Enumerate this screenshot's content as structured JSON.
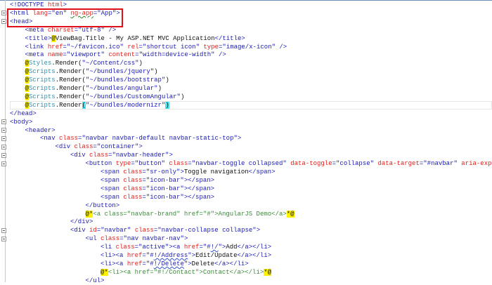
{
  "editor": {
    "lines": [
      {
        "indent": 0,
        "fold": false,
        "tokens": [
          {
            "t": "tag",
            "v": "<!DOCTYPE "
          },
          {
            "t": "attr",
            "v": "html"
          },
          {
            "t": "tag",
            "v": ">"
          }
        ]
      },
      {
        "indent": 0,
        "fold": true,
        "tokens": [
          {
            "t": "tag",
            "v": "<html "
          },
          {
            "t": "attr",
            "v": "lang"
          },
          {
            "t": "tag",
            "v": "="
          },
          {
            "t": "val",
            "v": "\"en\" "
          },
          {
            "t": "attr-squig",
            "v": "ng-app"
          },
          {
            "t": "tag",
            "v": "="
          },
          {
            "t": "val",
            "v": "\"App\""
          },
          {
            "t": "tag",
            "v": ">"
          }
        ]
      },
      {
        "indent": 0,
        "fold": true,
        "tokens": [
          {
            "t": "tag",
            "v": "<head>"
          }
        ]
      },
      {
        "indent": 1,
        "fold": false,
        "tokens": [
          {
            "t": "tag",
            "v": "<meta "
          },
          {
            "t": "attr",
            "v": "charset"
          },
          {
            "t": "tag",
            "v": "="
          },
          {
            "t": "val",
            "v": "\"utf-8\" "
          },
          {
            "t": "tag",
            "v": "/>"
          }
        ]
      },
      {
        "indent": 1,
        "fold": false,
        "tokens": [
          {
            "t": "tag",
            "v": "<title>"
          },
          {
            "t": "razor",
            "v": "@"
          },
          {
            "t": "text",
            "v": "ViewBag.Title - My ASP.NET MVC Application"
          },
          {
            "t": "tag",
            "v": "</title>"
          }
        ]
      },
      {
        "indent": 1,
        "fold": false,
        "tokens": [
          {
            "t": "tag",
            "v": "<link "
          },
          {
            "t": "attr",
            "v": "href"
          },
          {
            "t": "tag",
            "v": "="
          },
          {
            "t": "val",
            "v": "\"~/favicon.ico\" "
          },
          {
            "t": "attr",
            "v": "rel"
          },
          {
            "t": "tag",
            "v": "="
          },
          {
            "t": "val",
            "v": "\"shortcut icon\" "
          },
          {
            "t": "attr",
            "v": "type"
          },
          {
            "t": "tag",
            "v": "="
          },
          {
            "t": "val",
            "v": "\"image/x-icon\" "
          },
          {
            "t": "tag",
            "v": "/>"
          }
        ]
      },
      {
        "indent": 1,
        "fold": false,
        "tokens": [
          {
            "t": "tag",
            "v": "<meta "
          },
          {
            "t": "attr",
            "v": "name"
          },
          {
            "t": "tag",
            "v": "="
          },
          {
            "t": "val",
            "v": "\"viewport\" "
          },
          {
            "t": "attr",
            "v": "content"
          },
          {
            "t": "tag",
            "v": "="
          },
          {
            "t": "val",
            "v": "\"width=device-width\" "
          },
          {
            "t": "tag",
            "v": "/>"
          }
        ]
      },
      {
        "indent": 1,
        "fold": false,
        "tokens": [
          {
            "t": "razor",
            "v": "@"
          },
          {
            "t": "type",
            "v": "Styles"
          },
          {
            "t": "text",
            "v": ".Render("
          },
          {
            "t": "val",
            "v": "\"~/Content/css\""
          },
          {
            "t": "text",
            "v": ")"
          }
        ]
      },
      {
        "indent": 1,
        "fold": false,
        "tokens": [
          {
            "t": "razor",
            "v": "@"
          },
          {
            "t": "type",
            "v": "Scripts"
          },
          {
            "t": "text",
            "v": ".Render("
          },
          {
            "t": "val",
            "v": "\"~/bundles/jquery\""
          },
          {
            "t": "text",
            "v": ")"
          }
        ]
      },
      {
        "indent": 1,
        "fold": false,
        "tokens": [
          {
            "t": "razor",
            "v": "@"
          },
          {
            "t": "type",
            "v": "Scripts"
          },
          {
            "t": "text",
            "v": ".Render("
          },
          {
            "t": "val",
            "v": "\"~/bundles/bootstrap\""
          },
          {
            "t": "text",
            "v": ")"
          }
        ]
      },
      {
        "indent": 1,
        "fold": false,
        "tokens": [
          {
            "t": "razor",
            "v": "@"
          },
          {
            "t": "type",
            "v": "Scripts"
          },
          {
            "t": "text",
            "v": ".Render("
          },
          {
            "t": "val",
            "v": "\"~/bundles/angular\""
          },
          {
            "t": "text",
            "v": ")"
          }
        ]
      },
      {
        "indent": 1,
        "fold": false,
        "tokens": [
          {
            "t": "razor",
            "v": "@"
          },
          {
            "t": "type",
            "v": "Scripts"
          },
          {
            "t": "text",
            "v": ".Render("
          },
          {
            "t": "val",
            "v": "\"~/bundles/CustomAngular\""
          },
          {
            "t": "text",
            "v": ")"
          }
        ]
      },
      {
        "indent": 1,
        "fold": false,
        "tokens": [
          {
            "t": "razor",
            "v": "@"
          },
          {
            "t": "type",
            "v": "Scripts"
          },
          {
            "t": "text",
            "v": ".Render"
          },
          {
            "t": "brace",
            "v": "("
          },
          {
            "t": "val",
            "v": "\"~/bundles/modernizr\""
          },
          {
            "t": "brace",
            "v": ")"
          }
        ]
      },
      {
        "indent": 0,
        "fold": false,
        "tokens": [
          {
            "t": "tag",
            "v": "</head>"
          }
        ]
      },
      {
        "indent": 0,
        "fold": true,
        "tokens": [
          {
            "t": "tag",
            "v": "<body>"
          }
        ]
      },
      {
        "indent": 1,
        "fold": true,
        "tokens": [
          {
            "t": "tag",
            "v": "<header>"
          }
        ]
      },
      {
        "indent": 2,
        "fold": true,
        "tokens": [
          {
            "t": "tag",
            "v": "<nav "
          },
          {
            "t": "attr",
            "v": "class"
          },
          {
            "t": "tag",
            "v": "="
          },
          {
            "t": "val",
            "v": "\"navbar navbar-default navbar-static-top\""
          },
          {
            "t": "tag",
            "v": ">"
          }
        ]
      },
      {
        "indent": 3,
        "fold": true,
        "tokens": [
          {
            "t": "tag",
            "v": "<div "
          },
          {
            "t": "attr",
            "v": "class"
          },
          {
            "t": "tag",
            "v": "="
          },
          {
            "t": "val",
            "v": "\"container\""
          },
          {
            "t": "tag",
            "v": ">"
          }
        ]
      },
      {
        "indent": 4,
        "fold": true,
        "tokens": [
          {
            "t": "tag",
            "v": "<div "
          },
          {
            "t": "attr",
            "v": "class"
          },
          {
            "t": "tag",
            "v": "="
          },
          {
            "t": "val",
            "v": "\"navbar-header\""
          },
          {
            "t": "tag",
            "v": ">"
          }
        ]
      },
      {
        "indent": 5,
        "fold": true,
        "tokens": [
          {
            "t": "tag",
            "v": "<button "
          },
          {
            "t": "attr",
            "v": "type"
          },
          {
            "t": "tag",
            "v": "="
          },
          {
            "t": "val",
            "v": "\"button\" "
          },
          {
            "t": "attr",
            "v": "class"
          },
          {
            "t": "tag",
            "v": "="
          },
          {
            "t": "val",
            "v": "\"navbar-toggle collapsed\" "
          },
          {
            "t": "attr",
            "v": "data-toggle"
          },
          {
            "t": "tag",
            "v": "="
          },
          {
            "t": "val",
            "v": "\"collapse\" "
          },
          {
            "t": "attr",
            "v": "data-target"
          },
          {
            "t": "tag",
            "v": "="
          },
          {
            "t": "val",
            "v": "\"#navbar\" "
          },
          {
            "t": "attr",
            "v": "aria-expand"
          }
        ]
      },
      {
        "indent": 6,
        "fold": false,
        "tokens": [
          {
            "t": "tag",
            "v": "<span "
          },
          {
            "t": "attr",
            "v": "class"
          },
          {
            "t": "tag",
            "v": "="
          },
          {
            "t": "val",
            "v": "\"sr-only\""
          },
          {
            "t": "tag",
            "v": ">"
          },
          {
            "t": "text",
            "v": "Toggle navigation"
          },
          {
            "t": "tag",
            "v": "</span>"
          }
        ]
      },
      {
        "indent": 6,
        "fold": false,
        "tokens": [
          {
            "t": "tag",
            "v": "<span "
          },
          {
            "t": "attr",
            "v": "class"
          },
          {
            "t": "tag",
            "v": "="
          },
          {
            "t": "val",
            "v": "\"icon-bar\""
          },
          {
            "t": "tag",
            "v": "></span>"
          }
        ]
      },
      {
        "indent": 6,
        "fold": false,
        "tokens": [
          {
            "t": "tag",
            "v": "<span "
          },
          {
            "t": "attr",
            "v": "class"
          },
          {
            "t": "tag",
            "v": "="
          },
          {
            "t": "val",
            "v": "\"icon-bar\""
          },
          {
            "t": "tag",
            "v": "></span>"
          }
        ]
      },
      {
        "indent": 6,
        "fold": false,
        "tokens": [
          {
            "t": "tag",
            "v": "<span "
          },
          {
            "t": "attr",
            "v": "class"
          },
          {
            "t": "tag",
            "v": "="
          },
          {
            "t": "val",
            "v": "\"icon-bar\""
          },
          {
            "t": "tag",
            "v": "></span>"
          }
        ]
      },
      {
        "indent": 5,
        "fold": false,
        "tokens": [
          {
            "t": "tag",
            "v": "</button>"
          }
        ]
      },
      {
        "indent": 5,
        "fold": false,
        "tokens": [
          {
            "t": "razor",
            "v": "@*"
          },
          {
            "t": "comment",
            "v": "<a class=\"navbar-brand\" href=\"#\">AngularJS Demo</a>"
          },
          {
            "t": "razor",
            "v": "*@"
          }
        ]
      },
      {
        "indent": 4,
        "fold": false,
        "tokens": [
          {
            "t": "tag",
            "v": "</div>"
          }
        ]
      },
      {
        "indent": 4,
        "fold": true,
        "tokens": [
          {
            "t": "tag",
            "v": "<div "
          },
          {
            "t": "attr",
            "v": "id"
          },
          {
            "t": "tag",
            "v": "="
          },
          {
            "t": "val",
            "v": "\"navbar\" "
          },
          {
            "t": "attr",
            "v": "class"
          },
          {
            "t": "tag",
            "v": "="
          },
          {
            "t": "val",
            "v": "\"navbar-collapse collapse\""
          },
          {
            "t": "tag",
            "v": ">"
          }
        ]
      },
      {
        "indent": 5,
        "fold": true,
        "tokens": [
          {
            "t": "tag",
            "v": "<ul "
          },
          {
            "t": "attr",
            "v": "class"
          },
          {
            "t": "tag",
            "v": "="
          },
          {
            "t": "val",
            "v": "\"nav navbar-nav\""
          },
          {
            "t": "tag",
            "v": ">"
          }
        ]
      },
      {
        "indent": 6,
        "fold": false,
        "tokens": [
          {
            "t": "tag",
            "v": "<li "
          },
          {
            "t": "attr",
            "v": "class"
          },
          {
            "t": "tag",
            "v": "="
          },
          {
            "t": "val",
            "v": "\"active\""
          },
          {
            "t": "tag",
            "v": "><a "
          },
          {
            "t": "attr",
            "v": "href"
          },
          {
            "t": "tag",
            "v": "="
          },
          {
            "t": "val",
            "v": "\"#"
          },
          {
            "t": "val-squig",
            "v": "!/"
          },
          {
            "t": "val",
            "v": "\""
          },
          {
            "t": "tag",
            "v": ">"
          },
          {
            "t": "text",
            "v": "Add"
          },
          {
            "t": "tag",
            "v": "</a></li>"
          }
        ]
      },
      {
        "indent": 6,
        "fold": false,
        "tokens": [
          {
            "t": "tag",
            "v": "<li><a "
          },
          {
            "t": "attr",
            "v": "href"
          },
          {
            "t": "tag",
            "v": "="
          },
          {
            "t": "val",
            "v": "\"#"
          },
          {
            "t": "val-squig",
            "v": "!/Address"
          },
          {
            "t": "val",
            "v": "\""
          },
          {
            "t": "tag",
            "v": ">"
          },
          {
            "t": "text",
            "v": "Edit/Update"
          },
          {
            "t": "tag",
            "v": "</a></li>"
          }
        ]
      },
      {
        "indent": 6,
        "fold": false,
        "tokens": [
          {
            "t": "tag",
            "v": "<li><a "
          },
          {
            "t": "attr",
            "v": "href"
          },
          {
            "t": "tag",
            "v": "="
          },
          {
            "t": "val",
            "v": "\"#"
          },
          {
            "t": "val-squig",
            "v": "!/Delete"
          },
          {
            "t": "val",
            "v": "\""
          },
          {
            "t": "tag",
            "v": ">"
          },
          {
            "t": "text",
            "v": "Delete"
          },
          {
            "t": "tag",
            "v": "</a></li>"
          }
        ]
      },
      {
        "indent": 6,
        "fold": false,
        "tokens": [
          {
            "t": "razor",
            "v": "@*"
          },
          {
            "t": "comment",
            "v": "<li><a href=\"#!/Contact\">Contact</a></li>"
          },
          {
            "t": "razor",
            "v": "*@"
          }
        ]
      },
      {
        "indent": 5,
        "fold": false,
        "tokens": [
          {
            "t": "tag",
            "v": "</ul>"
          }
        ]
      }
    ]
  }
}
